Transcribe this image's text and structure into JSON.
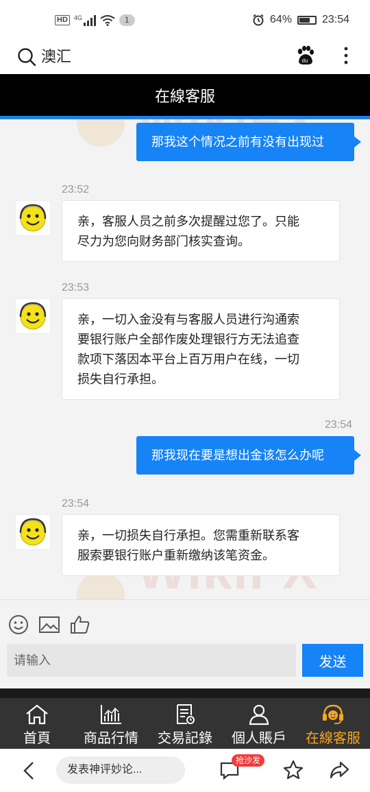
{
  "status_bar": {
    "hd": "HD",
    "network": "4G",
    "notifications": "1",
    "battery": "64%",
    "battery_level": 0.64,
    "time": "23:54"
  },
  "search_bar": {
    "query": "澳汇"
  },
  "chat": {
    "title": "在線客服",
    "messages": [
      {
        "side": "out",
        "time": "",
        "text": "那我这个情况之前有没有出现过"
      },
      {
        "side": "in",
        "time": "23:52",
        "lines": [
          "亲，客服人员之前多次提醒过您了。只能",
          "尽力为您向财务部门核实查询。"
        ]
      },
      {
        "side": "in",
        "time": "23:53",
        "lines": [
          "亲，一切入金没有与客服人员进行沟通索",
          "要银行账户全部作废处理银行方无法追查",
          "款项下落因本平台上百万用户在线，一切",
          "损失自行承担。"
        ]
      },
      {
        "side": "out",
        "time": "23:54",
        "text": "那我现在要是想出金该怎么办呢"
      },
      {
        "side": "in",
        "time": "23:54",
        "lines": [
          "亲，一切损失自行承担。您需重新联系客",
          "服索要银行账户重新缴纳该笔资金。"
        ]
      }
    ],
    "watermark": "WikiFX"
  },
  "input": {
    "placeholder": "请输入",
    "send_label": "发送"
  },
  "tabs": [
    {
      "label": "首頁",
      "icon": "home-icon",
      "active": false
    },
    {
      "label": "商品行情",
      "icon": "chart-icon",
      "active": false
    },
    {
      "label": "交易記錄",
      "icon": "records-icon",
      "active": false
    },
    {
      "label": "個人賬戶",
      "icon": "user-icon",
      "active": false
    },
    {
      "label": "在線客服",
      "icon": "headset-icon",
      "active": true
    }
  ],
  "browser_bar": {
    "comment_placeholder": "发表神评妙论...",
    "badge": "抢沙发"
  },
  "colors": {
    "accent": "#1683f6",
    "active_tab": "#f5a623",
    "header_bg": "#000000"
  }
}
